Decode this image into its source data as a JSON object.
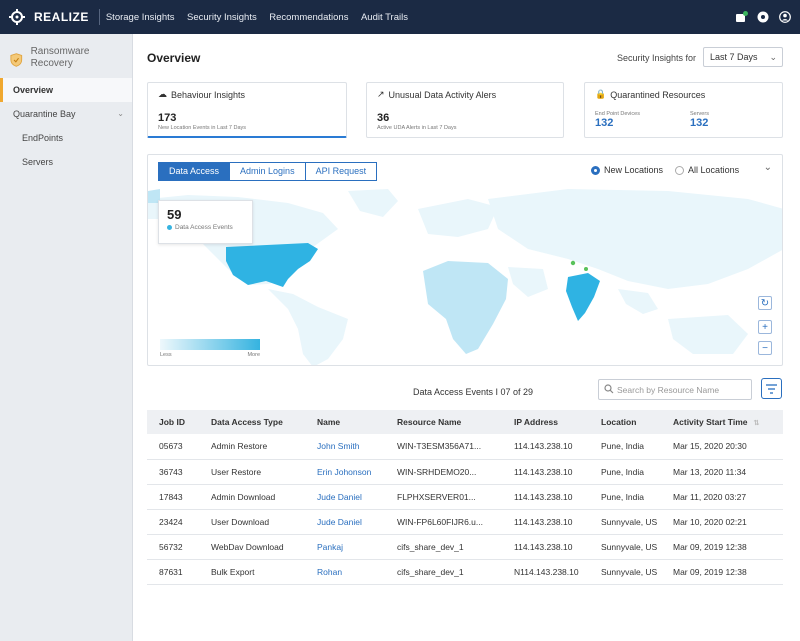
{
  "header": {
    "brand": "REALIZE",
    "nav": [
      "Storage Insights",
      "Security Insights",
      "Recommendations",
      "Audit Trails"
    ]
  },
  "sidebar": {
    "title": "Ransomware Recovery",
    "items": [
      {
        "label": "Overview",
        "active": true
      },
      {
        "label": "Quarantine Bay",
        "expandable": true
      },
      {
        "label": "EndPoints"
      },
      {
        "label": "Servers"
      }
    ]
  },
  "main": {
    "title": "Overview",
    "range_label": "Security Insights for",
    "range_value": "Last 7 Days",
    "cards": [
      {
        "title": "Behaviour Insights",
        "value": "173",
        "sub": "New Location Events in Last 7 Days"
      },
      {
        "title": "Unusual Data Activity Alers",
        "value": "36",
        "sub": "Active UDA Alerts in Last 7 Days"
      },
      {
        "title": "Quarantined Resources",
        "col1_label": "End Point Devices",
        "col1_value": "132",
        "col2_label": "Servers",
        "col2_value": "132"
      }
    ],
    "map": {
      "tabs": [
        "Data Access",
        "Admin Logins",
        "API Request"
      ],
      "radio_new": "New Locations",
      "radio_all": "All Locations",
      "tooltip_value": "59",
      "tooltip_label": "Data Access Events",
      "legend_less": "Less",
      "legend_more": "More",
      "colors": {
        "highlight": "#2fb3e3",
        "light": "#bfe6f5",
        "base": "#e9f6fb"
      }
    },
    "events_label": "Data Access Events I 07 of  29",
    "search_placeholder": "Search by Resource Name",
    "table": {
      "headers": [
        "Job ID",
        "Data Access Type",
        "Name",
        "Resource Name",
        "IP Address",
        "Location",
        "Activity Start Time"
      ],
      "rows": [
        [
          "05673",
          "Admin Restore",
          "John Smith",
          "WIN-T3ESM356A71...",
          "114.143.238.10",
          "Pune, India",
          "Mar 15, 2020 20:30"
        ],
        [
          "36743",
          "User Restore",
          "Erin Johonson",
          "WIN-SRHDEMO20...",
          "114.143.238.10",
          "Pune, India",
          "Mar 13, 2020 11:34"
        ],
        [
          "17843",
          "Admin Download",
          "Jude Daniel",
          "FLPHXSERVER01...",
          "114.143.238.10",
          "Pune, India",
          "Mar 11, 2020 03:27"
        ],
        [
          "23424",
          "User Download",
          "Jude Daniel",
          "WIN-FP6L60FIJR6.u...",
          "114.143.238.10",
          "Sunnyvale, US",
          "Mar 10, 2020 02:21"
        ],
        [
          "56732",
          "WebDav Download",
          "Pankaj",
          "cifs_share_dev_1",
          "114.143.238.10",
          "Sunnyvale, US",
          "Mar 09, 2019 12:38"
        ],
        [
          "87631",
          "Bulk Export",
          "Rohan",
          "cifs_share_dev_1",
          "N114.143.238.10",
          "Sunnyvale, US",
          "Mar 09, 2019 12:38"
        ]
      ]
    }
  }
}
